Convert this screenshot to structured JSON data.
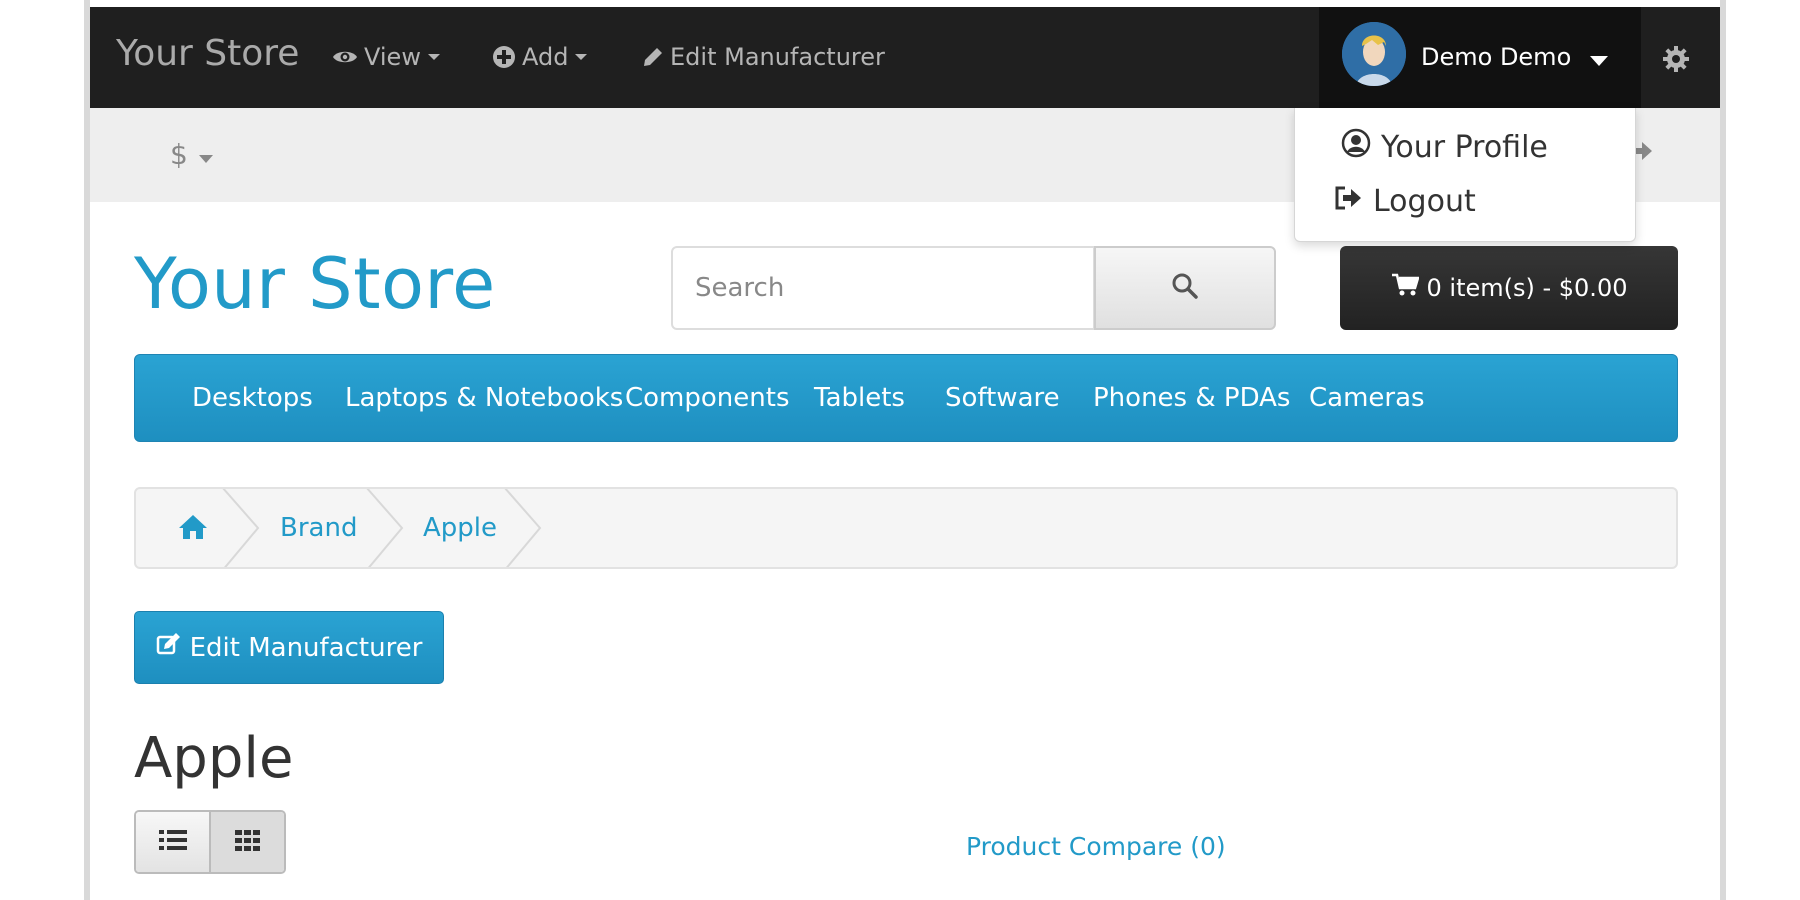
{
  "admin_bar": {
    "brand": "Your Store",
    "view_label": "View",
    "add_label": "Add",
    "edit_label": "Edit Manufacturer",
    "user_name": "Demo Demo"
  },
  "sub_bar": {
    "currency": "$"
  },
  "user_dropdown": {
    "items": [
      {
        "label": "Your Profile",
        "icon": "user-circle-icon"
      },
      {
        "label": "Logout",
        "icon": "sign-out-icon"
      }
    ]
  },
  "header": {
    "logo": "Your Store",
    "search_placeholder": "Search",
    "cart_label": "0 item(s) - $0.00"
  },
  "menu": {
    "items": [
      "Desktops",
      "Laptops & Notebooks",
      "Components",
      "Tablets",
      "Software",
      "Phones & PDAs",
      "Cameras"
    ]
  },
  "breadcrumb": {
    "items": [
      "Brand",
      "Apple"
    ]
  },
  "main": {
    "edit_button": "Edit Manufacturer",
    "title": "Apple",
    "compare_link": "Product Compare (0)"
  },
  "colors": {
    "accent": "#229ac8",
    "admin_bar": "#1f1f1f"
  }
}
